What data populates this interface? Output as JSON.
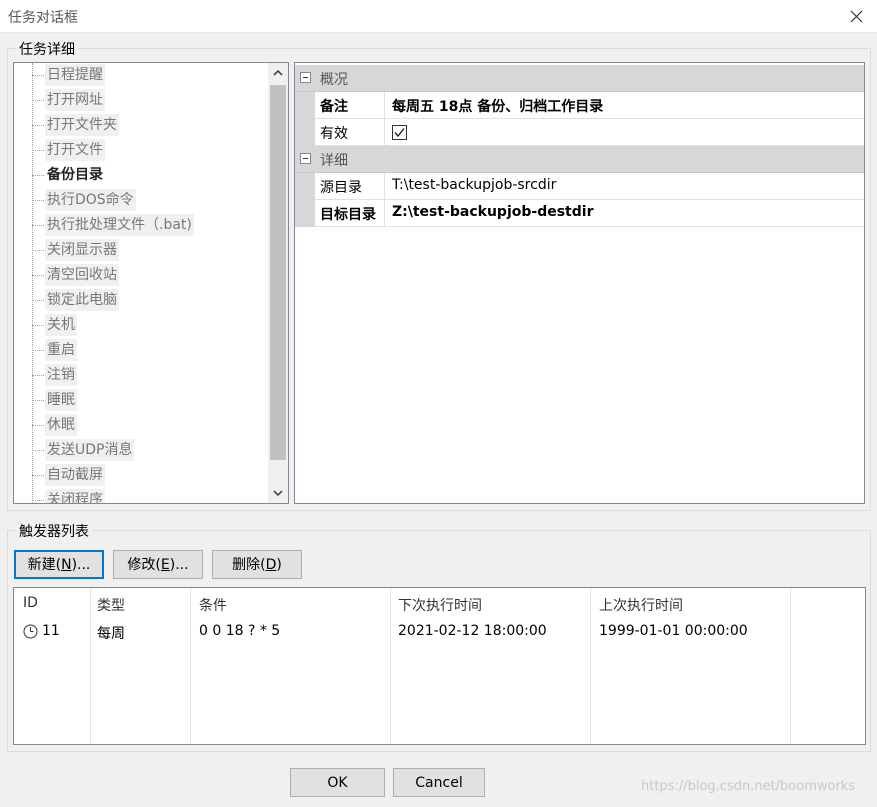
{
  "window": {
    "title": "任务对话框"
  },
  "task_details": {
    "group_label": "任务详细",
    "tree_items": [
      "日程提醒",
      "打开网址",
      "打开文件夹",
      "打开文件",
      "备份目录",
      "执行DOS命令",
      "执行批处理文件（.bat)",
      "关闭显示器",
      "清空回收站",
      "锁定此电脑",
      "关机",
      "重启",
      "注销",
      "睡眠",
      "休眠",
      "发送UDP消息",
      "自动截屏",
      "关闭程序"
    ],
    "selected_item": "备份目录",
    "properties": {
      "category1": "概况",
      "note_label": "备注",
      "note_value": "每周五 18点 备份、归档工作目录",
      "enabled_label": "有效",
      "enabled_value": true,
      "category2": "详细",
      "source_label": "源目录",
      "source_value": "T:\\test-backupjob-srcdir",
      "target_label": "目标目录",
      "target_value": "Z:\\test-backupjob-destdir"
    }
  },
  "triggers": {
    "group_label": "触发器列表",
    "buttons": {
      "new": {
        "text": "新建(",
        "key": "N",
        "tail": ")..."
      },
      "edit": {
        "text": "修改(",
        "key": "E",
        "tail": ")..."
      },
      "delete": {
        "text": "删除(",
        "key": "D",
        "tail": ")"
      }
    },
    "columns": [
      "ID",
      "类型",
      "条件",
      "下次执行时间",
      "上次执行时间"
    ],
    "rows": [
      {
        "id": "11",
        "type": "每周",
        "condition": "0 0 18 ? * 5",
        "next": "2021-02-12 18:00:00",
        "last": "1999-01-01 00:00:00"
      }
    ]
  },
  "footer": {
    "ok": "OK",
    "cancel": "Cancel"
  },
  "watermark": "https://blog.csdn.net/boomworks",
  "colors": {
    "accent": "#0078d7",
    "category_bg": "#d7d7d7"
  }
}
